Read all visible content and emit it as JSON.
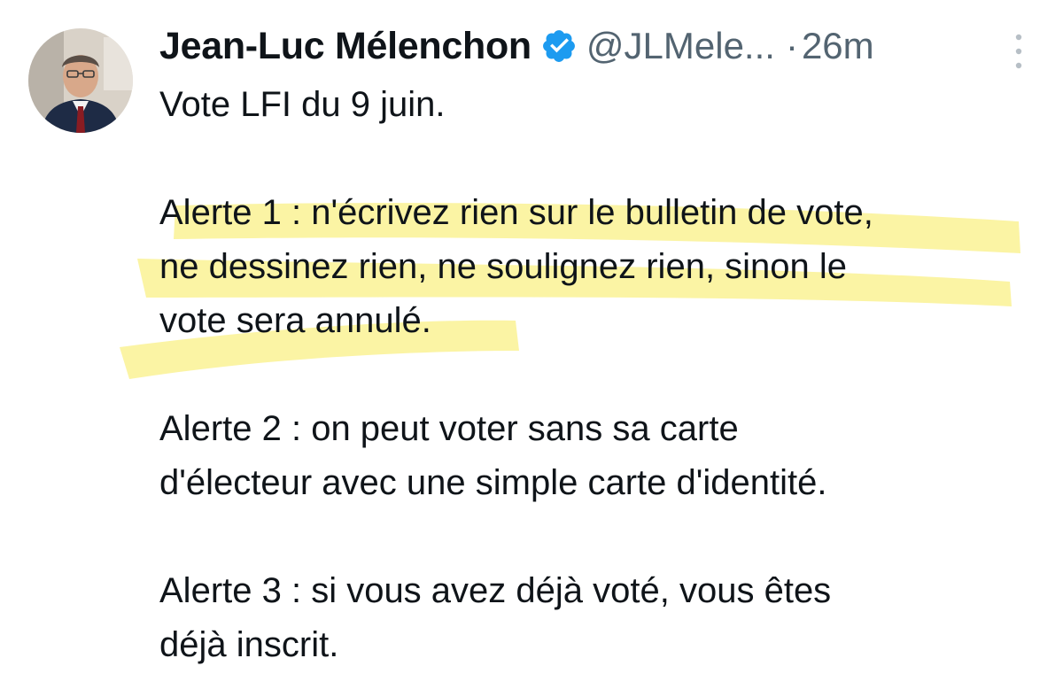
{
  "author": {
    "name": "Jean-Luc Mélenchon",
    "handle": "@JLMele...",
    "separator": "·",
    "time": "26m"
  },
  "icons": {
    "avatar": "profile-photo",
    "verified": "verified-badge-icon",
    "more": "more-vertical-icon"
  },
  "colors": {
    "verified": "#1d9bf0",
    "highlight": "#fbf39a",
    "secondary_text": "#536471"
  },
  "tweet": {
    "line1": "Vote LFI du 9 juin.",
    "alert1_line1": "Alerte 1 : n'écrivez rien sur le bulletin de vote,",
    "alert1_line2": "ne dessinez rien, ne soulignez rien, sinon le",
    "alert1_line3": "vote sera annulé.",
    "alert2_line1": "Alerte 2 : on peut voter sans sa carte",
    "alert2_line2": "d'électeur avec une simple carte d'identité.",
    "alert3_line1": "Alerte 3 : si vous avez déjà voté, vous êtes",
    "alert3_line2": "déjà inscrit."
  }
}
